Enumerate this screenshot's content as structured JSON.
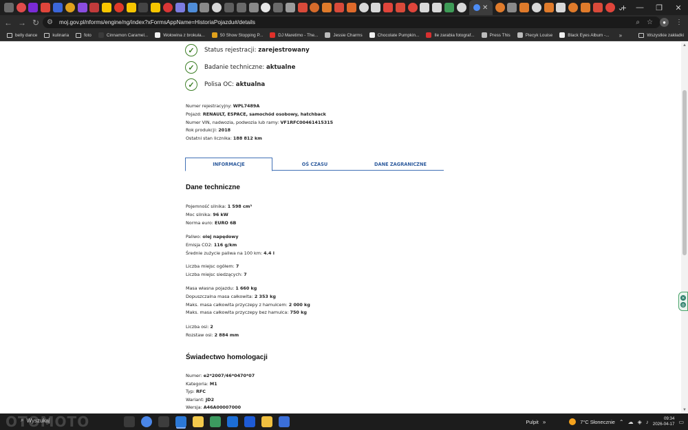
{
  "browser": {
    "tab_favicon_colors": [
      "#6a6a6a",
      "#e04b4b",
      "#7a2bd6",
      "#e0453b",
      "#3b66d9",
      "#e0a11c",
      "#8a4de0",
      "#c23b3b",
      "#f7c600",
      "#e03a2a",
      "#f7c600",
      "#444444",
      "#f7c600",
      "#d93636",
      "#7c7ce0",
      "#4f8dd9",
      "#8a8a8a",
      "#d8d8d8",
      "#5e5e5e",
      "#6a6a6a",
      "#8a8a8a",
      "#e8e8e8",
      "#6a6a6a",
      "#9b9b9b",
      "#d94a3a",
      "#d66b2b",
      "#e07b2b",
      "#d94a3a",
      "#e06a2b",
      "#d8d8d8",
      "#d8d8d8",
      "#e0453b",
      "#d94a3a",
      "#e0453b",
      "#d8d8d8",
      "#d8d8d8",
      "#3e9b57",
      "#d8d8d8"
    ],
    "tab_favicon_colors_after": [
      "#e07b2b",
      "#8a8a8a",
      "#e07b2b",
      "#d8d8d8",
      "#e07b2b",
      "#d8d8d8",
      "#e07b2b",
      "#e07b2b",
      "#d94a3a",
      "#e0453b"
    ],
    "new_tab_label": "+",
    "window_controls": [
      "⌄",
      "—",
      "❐",
      "✕"
    ],
    "url": "moj.gov.pl/nforms/engine/ng/index?xFormsAppName=HistoriaPojazdu#/details",
    "toolbar_icons": [
      "search-icon",
      "star-icon",
      "profile-icon",
      "menu-icon"
    ],
    "bookmarks": [
      {
        "label": "belly dance",
        "type": "folder"
      },
      {
        "label": "kulinaria",
        "type": "folder"
      },
      {
        "label": "foto",
        "type": "folder"
      },
      {
        "label": "Cinnamon Caramel...",
        "type": "site",
        "color": "#3a3a3a"
      },
      {
        "label": "Wołowina z brokuła...",
        "type": "site",
        "color": "#f0f0f0"
      },
      {
        "label": "50 Show Stopping P...",
        "type": "site",
        "color": "#e0a11c"
      },
      {
        "label": "DJ Maretimo - The...",
        "type": "site",
        "color": "#e0302a"
      },
      {
        "label": "Jessie Charms",
        "type": "site",
        "color": "#bbbbbb"
      },
      {
        "label": "Chocolate Pumpkin...",
        "type": "site",
        "color": "#f0f0f0"
      },
      {
        "label": "Ile zarabia fotograf...",
        "type": "site",
        "color": "#d83030"
      },
      {
        "label": "Press This",
        "type": "site",
        "color": "#bbbbbb"
      },
      {
        "label": "Piecyk Louise",
        "type": "site",
        "color": "#bbbbbb"
      },
      {
        "label": "Black Eyes Album -...",
        "type": "site",
        "color": "#f0f0f0"
      }
    ],
    "bookmarks_more": "»",
    "all_bookmarks_label": "Wszystkie zakładki"
  },
  "page": {
    "status": [
      {
        "label": "Status rejestracji: ",
        "value": "zarejestrowany"
      },
      {
        "label": "Badanie techniczne: ",
        "value": "aktualne"
      },
      {
        "label": "Polisa OC: ",
        "value": "aktualna"
      }
    ],
    "vehicle": [
      {
        "label": "Numer rejestracyjny: ",
        "value": "WPL7489A"
      },
      {
        "label": "Pojazd: ",
        "value": "RENAULT, ESPACE, samochód osobowy, hatchback"
      },
      {
        "label": "Numer VIN, nadwozia, podwozia lub ramy: ",
        "value": "VF1RFC00461415315"
      },
      {
        "label": "Rok produkcji: ",
        "value": "2018"
      },
      {
        "label": "Ostatni stan licznika: ",
        "value": "188 812 km"
      }
    ],
    "tabs": [
      {
        "label": "INFORMACJE",
        "active": true
      },
      {
        "label": "OŚ CZASU",
        "active": false
      },
      {
        "label": "DANE ZAGRANICZNE",
        "active": false
      }
    ],
    "tech_title": "Dane techniczne",
    "tech_groups": [
      [
        {
          "label": "Pojemność silnika: ",
          "value": "1 598 cm³"
        },
        {
          "label": "Moc silnika: ",
          "value": "96 kW"
        },
        {
          "label": "Norma euro: ",
          "value": "EURO 6B"
        }
      ],
      [
        {
          "label": "Paliwo: ",
          "value": "olej napędowy"
        },
        {
          "label": "Emisja CO2: ",
          "value": "116 g/km"
        },
        {
          "label": "Średnie zużycie paliwa na 100 km: ",
          "value": "4.4 l"
        }
      ],
      [
        {
          "label": "Liczba miejsc ogółem: ",
          "value": "7"
        },
        {
          "label": "Liczba miejsc siedzących: ",
          "value": "7"
        }
      ],
      [
        {
          "label": "Masa własna pojazdu: ",
          "value": "1 660 kg"
        },
        {
          "label": "Dopuszczalna masa całkowita: ",
          "value": "2 353 kg"
        },
        {
          "label": "Maks. masa całkowita przyczepy z hamulcem: ",
          "value": "2 000 kg"
        },
        {
          "label": "Maks. masa całkowita przyczepy bez hamulca: ",
          "value": "750 kg"
        }
      ],
      [
        {
          "label": "Liczba osi: ",
          "value": "2"
        },
        {
          "label": "Rozstaw osi: ",
          "value": "2 884 mm"
        }
      ]
    ],
    "homolog_title": "Świadectwo homologacji",
    "homolog": [
      {
        "label": "Numer: ",
        "value": "e2*2007/46*0470*07"
      },
      {
        "label": "Kategoria: ",
        "value": "M1"
      },
      {
        "label": "Typ: ",
        "value": "RFC"
      },
      {
        "label": "Wariant: ",
        "value": "JD2"
      },
      {
        "label": "Wersja: ",
        "value": "A46A00007000"
      }
    ]
  },
  "taskbar": {
    "watermark": "OTOMOTO",
    "search_placeholder": "Wyszukaj",
    "app_colors": [
      "#3a3a3a",
      "#4a86e8",
      "#3d3d3d",
      "#2b78d6",
      "#f2c94c",
      "#3c9a5f",
      "#1c6ed6",
      "#1e5bd6",
      "#f0c040",
      "#3b6fd9"
    ],
    "desktop_label": "Pulpit",
    "weather": "7°C  Słonecznie",
    "time": "09:34",
    "date": "2026-04-17"
  }
}
